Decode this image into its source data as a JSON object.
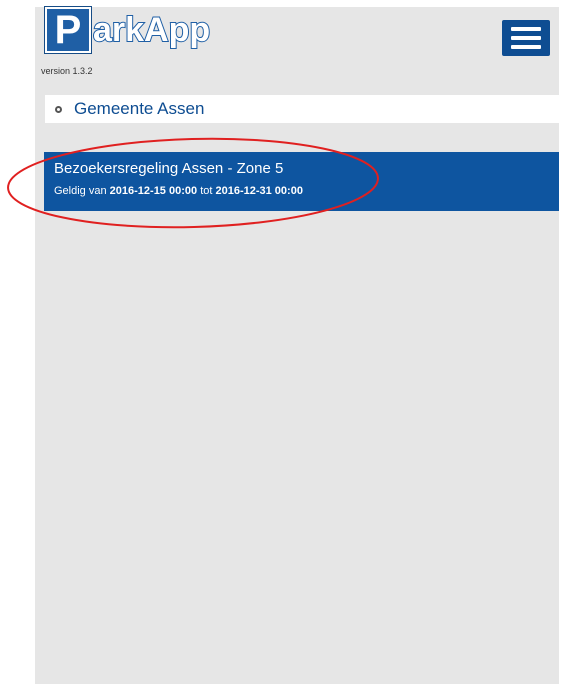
{
  "header": {
    "logo_letter": "P",
    "logo_text": "arkApp",
    "version": "version 1.3.2",
    "menu_icon": "hamburger-menu-icon"
  },
  "municipality": {
    "label": "Gemeente Assen",
    "icon": "bullet-icon"
  },
  "regulation": {
    "title": "Bezoekersregeling Assen - Zone 5",
    "valid_prefix": "Geldig van",
    "valid_from": "2016-12-15 00:00",
    "valid_mid": "tot",
    "valid_to": "2016-12-31 00:00"
  },
  "colors": {
    "brand_blue": "#0e55a0",
    "background": "#e6e6e6",
    "annotation": "#e02020"
  }
}
